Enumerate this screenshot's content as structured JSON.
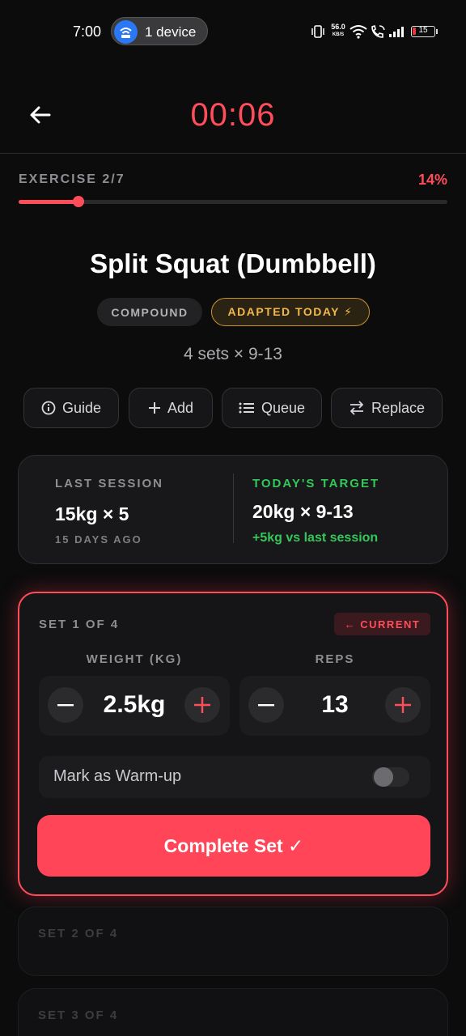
{
  "status_bar": {
    "time": "7:00",
    "device_pill": "1 device",
    "net_speed_value": "56.0",
    "net_speed_unit": "KB/S",
    "battery_level": "15"
  },
  "header": {
    "timer": "00:06"
  },
  "progress": {
    "label": "EXERCISE 2/7",
    "percent_text": "14%",
    "percent": 0.14
  },
  "exercise": {
    "title": "Split Squat (Dumbbell)",
    "tags": [
      "COMPOUND",
      "ADAPTED TODAY ⚡"
    ],
    "sets_summary": "4 sets × 9-13"
  },
  "actions": [
    "Guide",
    "Add",
    "Queue",
    "Replace"
  ],
  "summary": {
    "last_session_heading": "LAST SESSION",
    "last_session_value": "15kg × 5",
    "last_session_ago": "15 DAYS AGO",
    "target_heading": "TODAY'S TARGET",
    "target_value": "20kg × 9-13",
    "target_delta": "+5kg vs last session"
  },
  "current_set": {
    "label": "SET 1 OF 4",
    "badge": "← CURRENT",
    "weight_header": "WEIGHT (KG)",
    "weight_value": "2.5kg",
    "reps_header": "REPS",
    "reps_value": "13",
    "warmup_label": "Mark as Warm-up",
    "warmup_on": false,
    "complete_label": "Complete Set ✓"
  },
  "upcoming_sets": [
    "SET 2 OF 4",
    "SET 3 OF 4"
  ],
  "colors": {
    "accent": "#ff4d5a",
    "gold": "#f2b84b",
    "green": "#34c759",
    "background": "#0c0c0d"
  }
}
